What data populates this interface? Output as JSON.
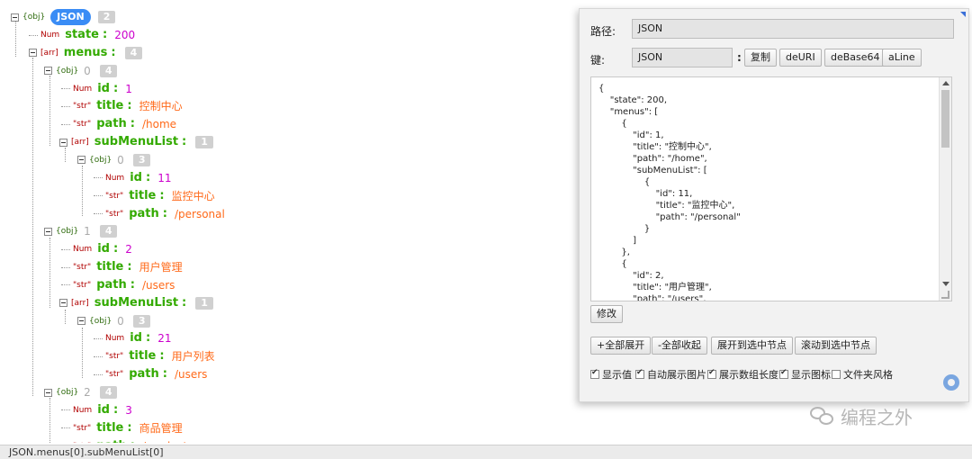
{
  "tree": {
    "root": {
      "type": "{obj}",
      "label": "JSON",
      "count": "2"
    },
    "rows": [
      {
        "kind": "num",
        "type": "Num",
        "key": "state",
        "colon": ":",
        "value": "200"
      },
      {
        "kind": "arr",
        "type": "[arr]",
        "key": "menus",
        "colon": ":",
        "count": "4"
      },
      {
        "kind": "obj",
        "type": "{obj}",
        "index": "0",
        "count": "4"
      },
      {
        "kind": "num",
        "type": "Num",
        "key": "id",
        "colon": ":",
        "value": "1"
      },
      {
        "kind": "str",
        "type": "\"str\"",
        "key": "title",
        "colon": ":",
        "value": "控制中心"
      },
      {
        "kind": "str",
        "type": "\"str\"",
        "key": "path",
        "colon": ":",
        "value": "/home"
      },
      {
        "kind": "arr",
        "type": "[arr]",
        "key": "subMenuList",
        "colon": ":",
        "count": "1"
      },
      {
        "kind": "obj",
        "type": "{obj}",
        "index": "0",
        "count": "3"
      },
      {
        "kind": "num",
        "type": "Num",
        "key": "id",
        "colon": ":",
        "value": "11"
      },
      {
        "kind": "str",
        "type": "\"str\"",
        "key": "title",
        "colon": ":",
        "value": "监控中心"
      },
      {
        "kind": "str",
        "type": "\"str\"",
        "key": "path",
        "colon": ":",
        "value": "/personal"
      },
      {
        "kind": "obj",
        "type": "{obj}",
        "index": "1",
        "count": "4"
      },
      {
        "kind": "num",
        "type": "Num",
        "key": "id",
        "colon": ":",
        "value": "2"
      },
      {
        "kind": "str",
        "type": "\"str\"",
        "key": "title",
        "colon": ":",
        "value": "用户管理"
      },
      {
        "kind": "str",
        "type": "\"str\"",
        "key": "path",
        "colon": ":",
        "value": "/users"
      },
      {
        "kind": "arr",
        "type": "[arr]",
        "key": "subMenuList",
        "colon": ":",
        "count": "1"
      },
      {
        "kind": "obj",
        "type": "{obj}",
        "index": "0",
        "count": "3"
      },
      {
        "kind": "num",
        "type": "Num",
        "key": "id",
        "colon": ":",
        "value": "21"
      },
      {
        "kind": "str",
        "type": "\"str\"",
        "key": "title",
        "colon": ":",
        "value": "用户列表"
      },
      {
        "kind": "str",
        "type": "\"str\"",
        "key": "path",
        "colon": ":",
        "value": "/users"
      },
      {
        "kind": "obj",
        "type": "{obj}",
        "index": "2",
        "count": "4"
      },
      {
        "kind": "num",
        "type": "Num",
        "key": "id",
        "colon": ":",
        "value": "3"
      },
      {
        "kind": "str",
        "type": "\"str\"",
        "key": "title",
        "colon": ":",
        "value": "商品管理"
      },
      {
        "kind": "str",
        "type": "\"str\"",
        "key": "path",
        "colon": ":",
        "value": "/products"
      }
    ]
  },
  "panel": {
    "path_label": "路径:",
    "path_value": "JSON",
    "key_label": "键:",
    "key_value": "JSON",
    "key_colon": ":",
    "copy_btn": "复制",
    "deuri_btn": "deURI",
    "debase64_btn": "deBase64",
    "aline_btn": "aLine",
    "json_text": "{\n    \"state\": 200,\n    \"menus\": [\n        {\n            \"id\": 1,\n            \"title\": \"控制中心\",\n            \"path\": \"/home\",\n            \"subMenuList\": [\n                {\n                    \"id\": 11,\n                    \"title\": \"监控中心\",\n                    \"path\": \"/personal\"\n                }\n            ]\n        },\n        {\n            \"id\": 2,\n            \"title\": \"用户管理\",\n            \"path\": \"/users\",",
    "modify_btn": "修改",
    "expand_all_btn": "+全部展开",
    "collapse_all_btn": "-全部收起",
    "expand_selected_btn": "展开到选中节点",
    "scroll_selected_btn": "滚动到选中节点",
    "options": [
      {
        "label": "显示值",
        "checked": true
      },
      {
        "label": "自动展示图片",
        "checked": true
      },
      {
        "label": "展示数组长度",
        "checked": true
      },
      {
        "label": "显示图标",
        "checked": true
      },
      {
        "label": "文件夹风格",
        "checked": false
      }
    ]
  },
  "status_bar": {
    "path": "JSON.menus[0].subMenuList[0]"
  },
  "watermark": {
    "text": "编程之外"
  }
}
